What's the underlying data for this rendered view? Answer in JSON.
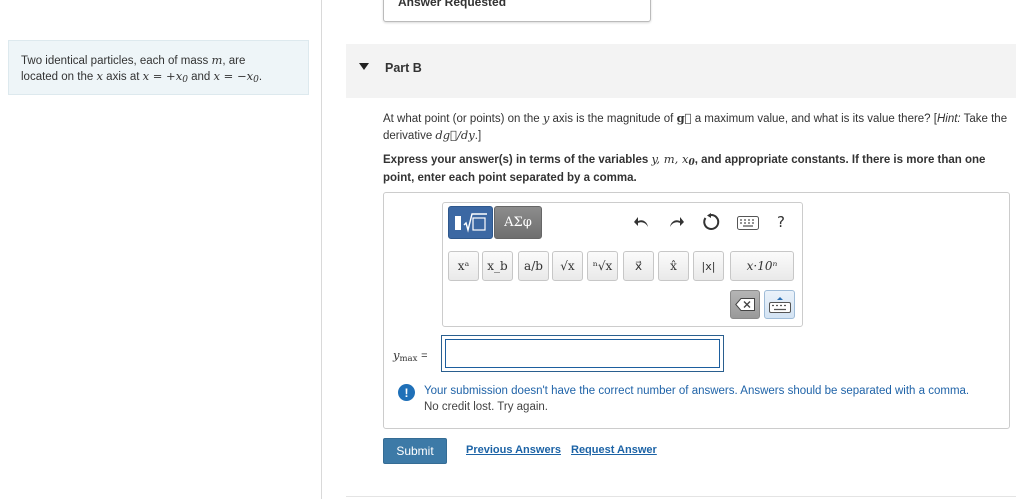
{
  "problem": {
    "line1_pre": "Two identical particles, each of mass",
    "mass_var": "m",
    "line1_post": ", are",
    "line2_pre": "located on the",
    "axis_var": "x",
    "line2_mid": "axis at",
    "pos_expr": "x = +x",
    "sub0": "0",
    "and": "and",
    "neg_expr": "x = −x",
    "sub0b": "0",
    "period": "."
  },
  "prev_button": {
    "label": "Answer Requested"
  },
  "part": {
    "title": "Part B"
  },
  "question": {
    "text_a": "At what point (or points) on the",
    "y_var": "y",
    "text_b": "axis is the magnitude of",
    "g_vec": "g⃗",
    "text_c": "a maximum value, and what is its value there? [",
    "hint_label": "Hint:",
    "text_d": " Take the derivative",
    "deriv": "dg⃗/dy",
    "text_e": ".]"
  },
  "instructions": {
    "text_a": "Express your answer(s) in terms of the variables",
    "vars": "y, m, x",
    "sub0": "0",
    "text_b": ", and appropriate constants. If there is more than one point, enter each point separated by a comma."
  },
  "toolbar": {
    "greek_label": "ΑΣφ",
    "help_label": "?",
    "math_buttons": [
      "xᵃ",
      "x_b",
      "a/b",
      "√x",
      "ⁿ√x",
      "x⃗",
      "x̂",
      "|x|",
      "x·10ⁿ"
    ]
  },
  "input": {
    "label_y": "y",
    "label_sub": "max",
    "label_eq": "=",
    "value": ""
  },
  "feedback": {
    "icon": "!",
    "line1": "Your submission doesn't have the correct number of answers. Answers should be separated with a comma.",
    "line2": "No credit lost. Try again."
  },
  "actions": {
    "submit_label": "Submit",
    "previous_answers_label": "Previous Answers",
    "request_answer_label": "Request Answer"
  },
  "colors": {
    "accent_blue": "#3d7aa7",
    "link_blue": "#1c63a6",
    "template_btn_blue": "#3c68a3",
    "problem_bg": "#eef5f8"
  }
}
